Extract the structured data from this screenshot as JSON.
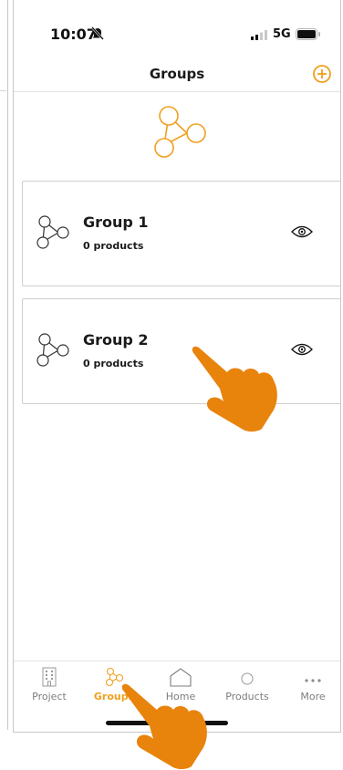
{
  "status_bar": {
    "time": "10:07",
    "network": "5G"
  },
  "header": {
    "title": "Groups"
  },
  "groups": [
    {
      "name": "Group 1",
      "count": "0 products"
    },
    {
      "name": "Group 2",
      "count": "0 products"
    }
  ],
  "tabs": [
    {
      "label": "Project"
    },
    {
      "label": "Groups"
    },
    {
      "label": "Home"
    },
    {
      "label": "Products"
    },
    {
      "label": "More"
    }
  ],
  "colors": {
    "accent": "#f0a020",
    "hand": "#e8830c",
    "text": "#1a1a1a",
    "muted": "#7d7d7d"
  }
}
